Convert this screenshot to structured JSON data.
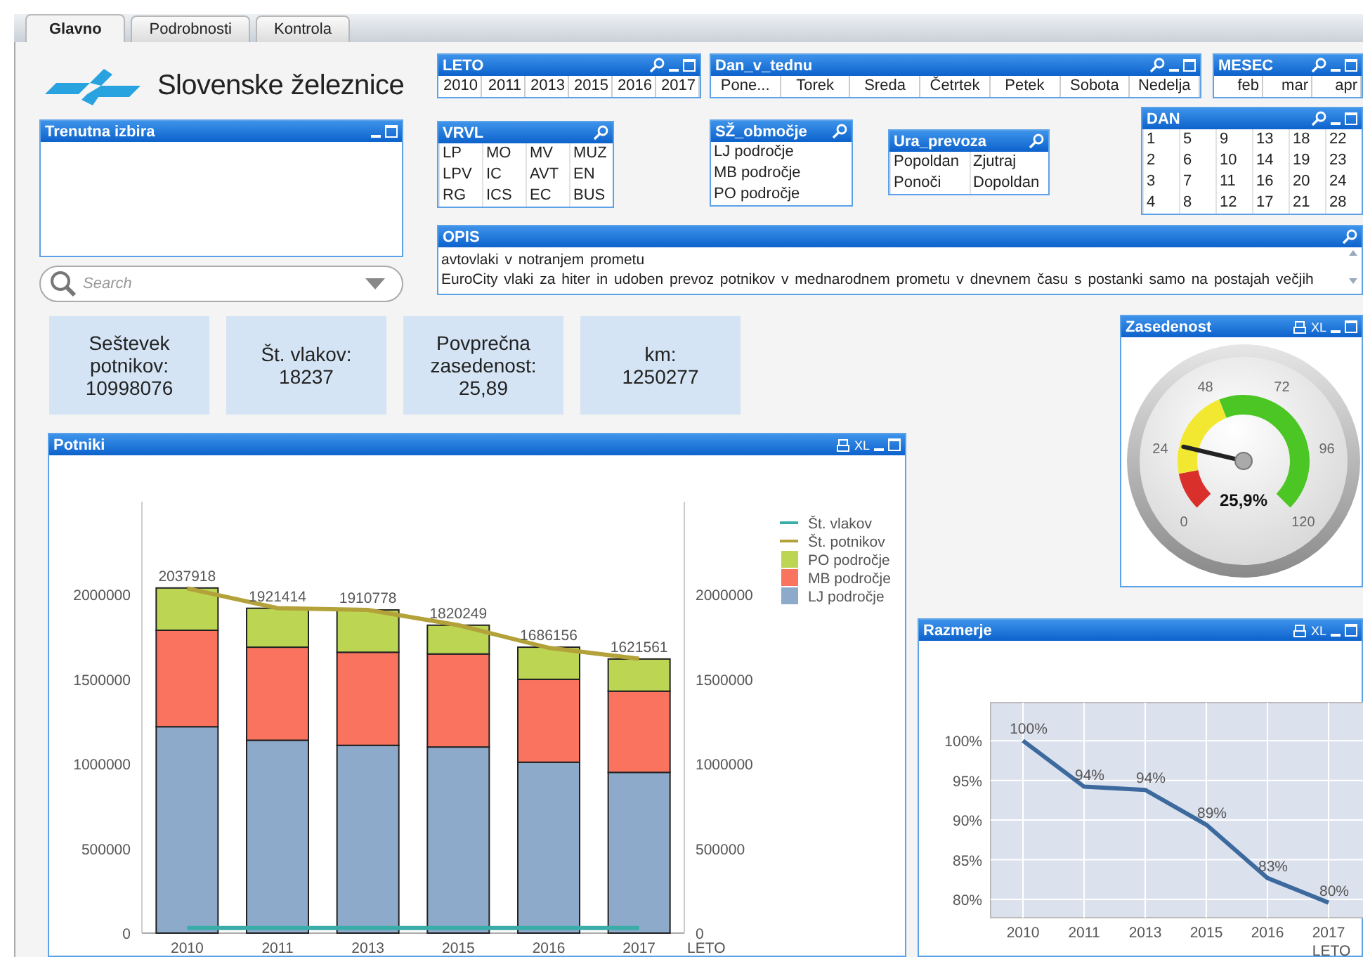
{
  "tabs": [
    {
      "label": "Glavno",
      "selected": true
    },
    {
      "label": "Podrobnosti",
      "selected": false
    },
    {
      "label": "Kontrola",
      "selected": false
    }
  ],
  "logo": {
    "text": "Slovenske železnice"
  },
  "current_selections": {
    "title": "Trenutna izbira",
    "controls": [
      {
        "kind": "minimize"
      },
      {
        "kind": "maximize"
      }
    ]
  },
  "search": {
    "placeholder": "Search"
  },
  "listboxes": [
    {
      "title": "LETO",
      "controls": [
        {
          "kind": "search"
        },
        {
          "kind": "minimize"
        },
        {
          "kind": "maximize"
        }
      ],
      "values": [
        "2010",
        "2011",
        "2013",
        "2015",
        "2016",
        "2017"
      ]
    },
    {
      "title": "Dan_v_tednu",
      "controls": [
        {
          "kind": "search"
        },
        {
          "kind": "minimize"
        },
        {
          "kind": "maximize"
        }
      ],
      "values": [
        "Pone...",
        "Torek",
        "Sreda",
        "Četrtek",
        "Petek",
        "Sobota",
        "Nedelja"
      ]
    },
    {
      "title": "MESEC",
      "controls": [
        {
          "kind": "search"
        },
        {
          "kind": "minimize"
        },
        {
          "kind": "maximize"
        }
      ],
      "values": [
        "feb",
        "mar",
        "apr"
      ]
    },
    {
      "title": "VRVL",
      "controls": [
        {
          "kind": "search"
        }
      ],
      "values": [
        "LP",
        "MO",
        "MV",
        "MUZ",
        "LPV",
        "IC",
        "AVT",
        "EN",
        "RG",
        "ICS",
        "EC",
        "BUS"
      ]
    },
    {
      "title": "SŽ_območje",
      "controls": [
        {
          "kind": "search"
        }
      ],
      "values": [
        "LJ področje",
        "MB področje",
        "PO področje"
      ]
    },
    {
      "title": "Ura_prevoza",
      "controls": [
        {
          "kind": "search"
        }
      ],
      "values": [
        "Popoldan",
        "Zjutraj",
        "Ponoči",
        "Dopoldan"
      ]
    },
    {
      "title": "DAN",
      "controls": [
        {
          "kind": "search"
        },
        {
          "kind": "minimize"
        },
        {
          "kind": "maximize"
        }
      ],
      "values": [
        "1",
        "5",
        "9",
        "13",
        "18",
        "22",
        "2",
        "6",
        "10",
        "14",
        "19",
        "23",
        "3",
        "7",
        "11",
        "16",
        "20",
        "24",
        "4",
        "8",
        "12",
        "17",
        "21",
        "28"
      ]
    }
  ],
  "opis": {
    "title": "OPIS",
    "controls": [
      {
        "kind": "search"
      }
    ],
    "lines": [
      "avtovlaki v notranjem prometu",
      "EuroCity vlaki za hiter  in udoben prevoz potnikov v mednarodnem prometu v dnevnem času s postanki samo na postajah večjih"
    ]
  },
  "kpis": [
    {
      "label": "Seštevek potnikov:",
      "value": "10998076"
    },
    {
      "label": "Št. vlakov:",
      "value": "18237"
    },
    {
      "label": "Povprečna zasedenost:",
      "value": "25,89"
    },
    {
      "label": "km:",
      "value": "1250277"
    }
  ],
  "gauge": {
    "title": "Zasedenost",
    "controls": [
      {
        "kind": "print"
      },
      {
        "kind": "xl",
        "label": "XL"
      },
      {
        "kind": "minimize"
      },
      {
        "kind": "maximize"
      }
    ],
    "ticks": [
      "0",
      "24",
      "48",
      "72",
      "96",
      "120"
    ],
    "reading": "25,9%"
  },
  "potniki": {
    "title": "Potniki",
    "controls": [
      {
        "kind": "print"
      },
      {
        "kind": "xl",
        "label": "XL"
      },
      {
        "kind": "minimize"
      },
      {
        "kind": "maximize"
      }
    ],
    "chart_data": {
      "type": "bar",
      "stacked": true,
      "xlabel": "LETO",
      "categories": [
        "2010",
        "2011",
        "2013",
        "2015",
        "2016",
        "2017"
      ],
      "ylim": [
        0,
        2550000
      ],
      "yticks": [
        0,
        500000,
        1000000,
        1500000,
        2000000
      ],
      "y2ticks": [
        0,
        500000,
        1000000,
        1500000,
        2000000
      ],
      "y2lim": [
        0,
        2550000
      ],
      "legend": true,
      "series": [
        {
          "name": "Št. vlakov",
          "type": "line",
          "color": "#3aada8",
          "values": [
            30000,
            30000,
            30000,
            30000,
            30000,
            30000
          ]
        },
        {
          "name": "Št. potnikov",
          "type": "line",
          "color": "#b3a23a",
          "values": [
            2037918,
            1921414,
            1910778,
            1820249,
            1686156,
            1621561
          ]
        },
        {
          "name": "PO področje",
          "type": "bar",
          "color": "#bcd654",
          "values": [
            250000,
            230000,
            250000,
            170000,
            190000,
            190000
          ]
        },
        {
          "name": "MB področje",
          "type": "bar",
          "color": "#fa735f",
          "values": [
            570000,
            550000,
            550000,
            550000,
            490000,
            480000
          ]
        },
        {
          "name": "LJ področje",
          "type": "bar",
          "color": "#8eaacb",
          "values": [
            1220000,
            1140000,
            1110000,
            1100000,
            1010000,
            950000
          ]
        }
      ],
      "value_labels": [
        "2037918",
        "1921414",
        "1910778",
        "1820249",
        "1686156",
        "1621561"
      ]
    }
  },
  "razmerje": {
    "title": "Razmerje",
    "controls": [
      {
        "kind": "print"
      },
      {
        "kind": "xl",
        "label": "XL"
      },
      {
        "kind": "minimize"
      },
      {
        "kind": "maximize"
      }
    ],
    "chart_data": {
      "type": "line",
      "grid": true,
      "xlabel": "LETO",
      "categories": [
        "2010",
        "2011",
        "2013",
        "2015",
        "2016",
        "2017"
      ],
      "ylim": [
        77.7,
        104.8
      ],
      "yticks": [
        {
          "value": 80,
          "label": "80%"
        },
        {
          "value": 85,
          "label": "85%"
        },
        {
          "value": 90,
          "label": "90%"
        },
        {
          "value": 95,
          "label": "95%"
        },
        {
          "value": 100,
          "label": "100%"
        }
      ],
      "series": [
        {
          "color": "#3d6a9e",
          "values": [
            100,
            94.2,
            93.8,
            89.4,
            82.7,
            79.6
          ]
        }
      ],
      "value_labels": [
        "100%",
        "94%",
        "94%",
        "89%",
        "83%",
        "80%"
      ]
    }
  }
}
